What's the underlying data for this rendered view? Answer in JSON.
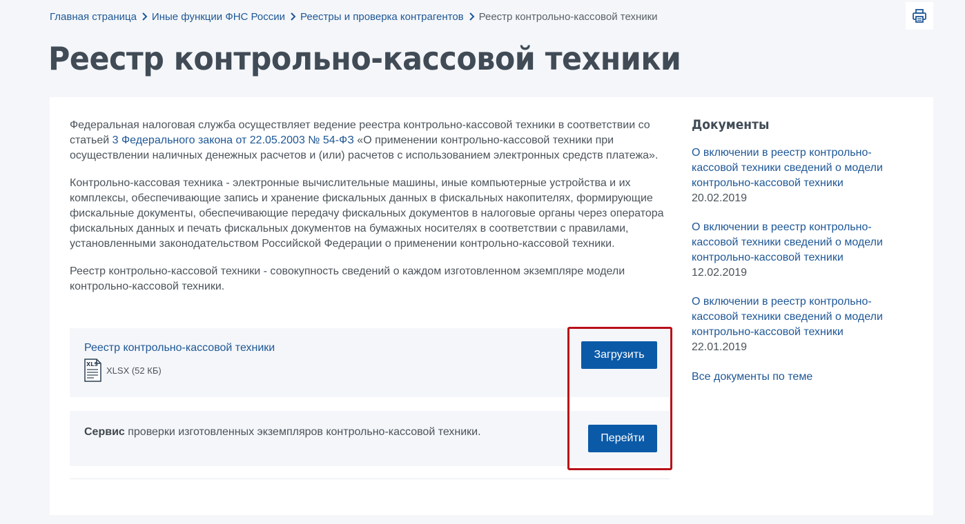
{
  "breadcrumb": {
    "items": [
      "Главная страница",
      "Иные функции ФНС России",
      "Реестры и проверка контрагентов"
    ],
    "current": "Реестр контрольно-кассовой техники"
  },
  "page": {
    "title": "Реестр контрольно-кассовой техники"
  },
  "main": {
    "para1_before_link": "Федеральная налоговая служба осуществляет ведение реестра контрольно-кассовой техники в соответствии со статьей ",
    "para1_link": "3 Федерального закона от 22.05.2003 № 54-ФЗ",
    "para1_after_link": " «О применении контрольно-кассовой техники при осуществлении наличных денежных расчетов и (или) расчетов с использованием электронных средств платежа».",
    "para2": "Контрольно-кассовая техника - электронные вычислительные машины, иные компьютерные устройства и их комплексы, обеспечивающие запись и хранение фискальных данных в фискальных накопителях, формирующие фискальные документы, обеспечивающие передачу фискальных документов в налоговые органы через оператора фискальных данных и печать фискальных документов на бумажных носителях в соответствии с правилами, установленными законодательством Российской Федерации о применении контрольно-кассовой техники.",
    "para3": "Реестр контрольно-кассовой техники - совокупность сведений о каждом изготовленном экземпляре модели контрольно-кассовой техники."
  },
  "download_item": {
    "title": "Реестр контрольно-кассовой техники",
    "file_meta": "XLSX (52 КБ)",
    "file_icon_label": "XLS",
    "button_label": "Загрузить"
  },
  "service_item": {
    "bold": "Сервис",
    "text": " проверки изготовленных экземпляров контрольно-кассовой техники.",
    "button_label": "Перейти"
  },
  "sidebar": {
    "title": "Документы",
    "documents": [
      {
        "title": "О включении в реестр контрольно-кассовой техники сведений о модели контрольно-кассовой техники",
        "date": "20.02.2019"
      },
      {
        "title": "О включении в реестр контрольно-кассовой техники сведений о модели контрольно-кассовой техники",
        "date": "12.02.2019"
      },
      {
        "title": "О включении в реестр контрольно-кассовой техники сведений о модели контрольно-кассовой техники",
        "date": "22.01.2019"
      }
    ],
    "all_docs_label": "Все документы по теме"
  },
  "colors": {
    "background": "#f4f6f9",
    "link": "#1e5796",
    "button": "#0b5aa8",
    "highlight_border": "#b80e18",
    "title": "#404b56"
  },
  "icons": [
    "chevron-right-icon",
    "printer-icon",
    "xls-file-icon"
  ]
}
